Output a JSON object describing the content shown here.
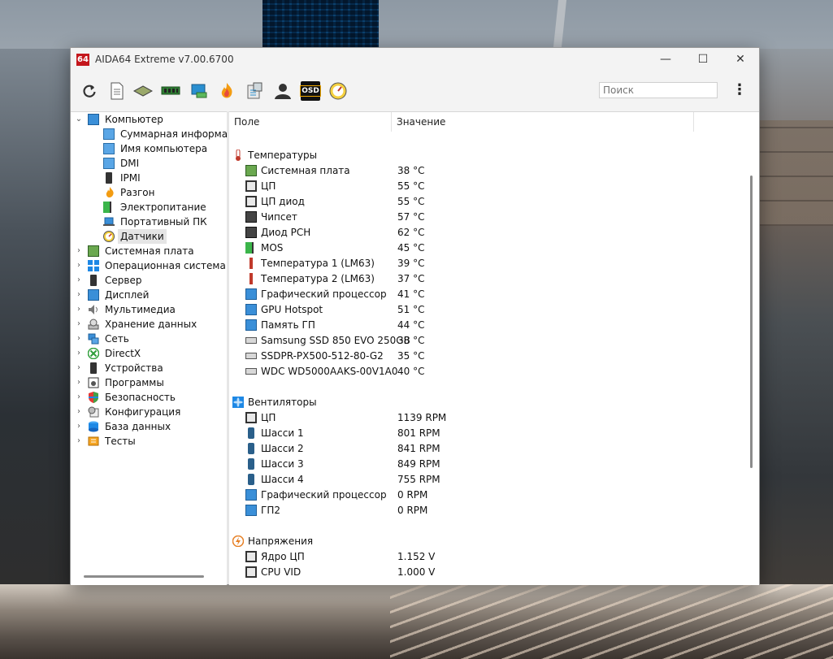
{
  "window": {
    "app_icon_text": "64",
    "title": "AIDA64 Extreme v7.00.6700",
    "minimize": "—",
    "maximize": "☐",
    "close": "✕"
  },
  "toolbar": {
    "icons": [
      "refresh-icon",
      "report-icon",
      "motherboard-icon",
      "memory-icon",
      "gpu-card-icon",
      "flame-stress-icon",
      "benchmark-icon",
      "user-icon",
      "osd-icon",
      "gauge-icon"
    ],
    "osd_label": "OSD",
    "search_placeholder": "Поиск",
    "more": "⋮"
  },
  "tree": {
    "root": {
      "label": "Компьютер",
      "expander": "⌄"
    },
    "children": [
      {
        "label": "Суммарная информаци",
        "icon": "monitor-icon"
      },
      {
        "label": "Имя компьютера",
        "icon": "monitor-icon"
      },
      {
        "label": "DMI",
        "icon": "monitor-icon"
      },
      {
        "label": "IPMI",
        "icon": "phone-icon"
      },
      {
        "label": "Разгон",
        "icon": "flame-icon"
      },
      {
        "label": "Электропитание",
        "icon": "battery-icon"
      },
      {
        "label": "Портативный ПК",
        "icon": "laptop-icon"
      },
      {
        "label": "Датчики",
        "icon": "gauge-icon",
        "selected": true
      }
    ],
    "categories": [
      {
        "label": "Системная плата",
        "icon": "motherboard-icon"
      },
      {
        "label": "Операционная система",
        "icon": "windows-icon"
      },
      {
        "label": "Сервер",
        "icon": "server-icon"
      },
      {
        "label": "Дисплей",
        "icon": "display-icon"
      },
      {
        "label": "Мультимедиа",
        "icon": "speaker-icon"
      },
      {
        "label": "Хранение данных",
        "icon": "storage-icon"
      },
      {
        "label": "Сеть",
        "icon": "network-icon"
      },
      {
        "label": "DirectX",
        "icon": "xbox-icon"
      },
      {
        "label": "Устройства",
        "icon": "devices-icon"
      },
      {
        "label": "Программы",
        "icon": "programs-icon"
      },
      {
        "label": "Безопасность",
        "icon": "shield-icon"
      },
      {
        "label": "Конфигурация",
        "icon": "config-icon"
      },
      {
        "label": "База данных",
        "icon": "database-icon"
      },
      {
        "label": "Тесты",
        "icon": "tests-icon"
      }
    ],
    "collapsed_expander": "›"
  },
  "table": {
    "columns": [
      "Поле",
      "Значение"
    ],
    "groups": [
      {
        "label": "Температуры",
        "icon": "thermometer-icon",
        "rows": [
          {
            "field": "Системная плата",
            "value": "38 °C",
            "icon": "motherboard-icon"
          },
          {
            "field": "ЦП",
            "value": "55 °C",
            "icon": "cpu-icon"
          },
          {
            "field": "ЦП диод",
            "value": "55 °C",
            "icon": "cpu-icon"
          },
          {
            "field": "Чипсет",
            "value": "57 °C",
            "icon": "chipset-icon"
          },
          {
            "field": "Диод PCH",
            "value": "62 °C",
            "icon": "chipset-icon"
          },
          {
            "field": "MOS",
            "value": "45 °C",
            "icon": "mos-icon"
          },
          {
            "field": "Температура 1 (LM63)",
            "value": "39 °C",
            "icon": "thermometer-icon"
          },
          {
            "field": "Температура 2 (LM63)",
            "value": "37 °C",
            "icon": "thermometer-icon"
          },
          {
            "field": "Графический процессор",
            "value": "41 °C",
            "icon": "gpu-icon"
          },
          {
            "field": "GPU Hotspot",
            "value": "51 °C",
            "icon": "gpu-icon"
          },
          {
            "field": "Память ГП",
            "value": "44 °C",
            "icon": "gpu-icon"
          },
          {
            "field": "Samsung SSD 850 EVO 250GB",
            "value": "38 °C",
            "icon": "drive-icon"
          },
          {
            "field": "SSDPR-PX500-512-80-G2",
            "value": "35 °C",
            "icon": "drive-icon"
          },
          {
            "field": "WDC WD5000AAKS-00V1A0",
            "value": "40 °C",
            "icon": "drive-icon"
          }
        ]
      },
      {
        "label": "Вентиляторы",
        "icon": "fan-icon",
        "rows": [
          {
            "field": "ЦП",
            "value": "1139 RPM",
            "icon": "cpu-icon"
          },
          {
            "field": "Шасси 1",
            "value": "801 RPM",
            "icon": "case-icon"
          },
          {
            "field": "Шасси 2",
            "value": "841 RPM",
            "icon": "case-icon"
          },
          {
            "field": "Шасси 3",
            "value": "849 RPM",
            "icon": "case-icon"
          },
          {
            "field": "Шасси 4",
            "value": "755 RPM",
            "icon": "case-icon"
          },
          {
            "field": "Графический процессор",
            "value": "0 RPM",
            "icon": "gpu-icon"
          },
          {
            "field": "ГП2",
            "value": "0 RPM",
            "icon": "gpu-icon"
          }
        ]
      },
      {
        "label": "Напряжения",
        "icon": "voltage-icon",
        "rows": [
          {
            "field": "Ядро ЦП",
            "value": "1.152 V",
            "icon": "cpu-icon"
          },
          {
            "field": "CPU VID",
            "value": "1.000 V",
            "icon": "cpu-icon"
          }
        ]
      }
    ]
  }
}
